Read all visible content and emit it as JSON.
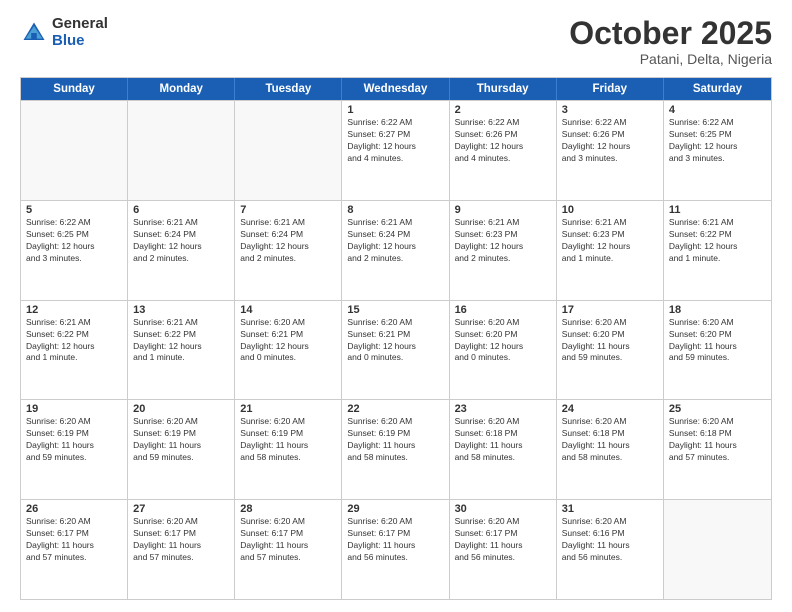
{
  "header": {
    "logo_general": "General",
    "logo_blue": "Blue",
    "title": "October 2025",
    "subtitle": "Patani, Delta, Nigeria"
  },
  "days": [
    "Sunday",
    "Monday",
    "Tuesday",
    "Wednesday",
    "Thursday",
    "Friday",
    "Saturday"
  ],
  "weeks": [
    [
      {
        "day": "",
        "info": ""
      },
      {
        "day": "",
        "info": ""
      },
      {
        "day": "",
        "info": ""
      },
      {
        "day": "1",
        "info": "Sunrise: 6:22 AM\nSunset: 6:27 PM\nDaylight: 12 hours\nand 4 minutes."
      },
      {
        "day": "2",
        "info": "Sunrise: 6:22 AM\nSunset: 6:26 PM\nDaylight: 12 hours\nand 4 minutes."
      },
      {
        "day": "3",
        "info": "Sunrise: 6:22 AM\nSunset: 6:26 PM\nDaylight: 12 hours\nand 3 minutes."
      },
      {
        "day": "4",
        "info": "Sunrise: 6:22 AM\nSunset: 6:25 PM\nDaylight: 12 hours\nand 3 minutes."
      }
    ],
    [
      {
        "day": "5",
        "info": "Sunrise: 6:22 AM\nSunset: 6:25 PM\nDaylight: 12 hours\nand 3 minutes."
      },
      {
        "day": "6",
        "info": "Sunrise: 6:21 AM\nSunset: 6:24 PM\nDaylight: 12 hours\nand 2 minutes."
      },
      {
        "day": "7",
        "info": "Sunrise: 6:21 AM\nSunset: 6:24 PM\nDaylight: 12 hours\nand 2 minutes."
      },
      {
        "day": "8",
        "info": "Sunrise: 6:21 AM\nSunset: 6:24 PM\nDaylight: 12 hours\nand 2 minutes."
      },
      {
        "day": "9",
        "info": "Sunrise: 6:21 AM\nSunset: 6:23 PM\nDaylight: 12 hours\nand 2 minutes."
      },
      {
        "day": "10",
        "info": "Sunrise: 6:21 AM\nSunset: 6:23 PM\nDaylight: 12 hours\nand 1 minute."
      },
      {
        "day": "11",
        "info": "Sunrise: 6:21 AM\nSunset: 6:22 PM\nDaylight: 12 hours\nand 1 minute."
      }
    ],
    [
      {
        "day": "12",
        "info": "Sunrise: 6:21 AM\nSunset: 6:22 PM\nDaylight: 12 hours\nand 1 minute."
      },
      {
        "day": "13",
        "info": "Sunrise: 6:21 AM\nSunset: 6:22 PM\nDaylight: 12 hours\nand 1 minute."
      },
      {
        "day": "14",
        "info": "Sunrise: 6:20 AM\nSunset: 6:21 PM\nDaylight: 12 hours\nand 0 minutes."
      },
      {
        "day": "15",
        "info": "Sunrise: 6:20 AM\nSunset: 6:21 PM\nDaylight: 12 hours\nand 0 minutes."
      },
      {
        "day": "16",
        "info": "Sunrise: 6:20 AM\nSunset: 6:20 PM\nDaylight: 12 hours\nand 0 minutes."
      },
      {
        "day": "17",
        "info": "Sunrise: 6:20 AM\nSunset: 6:20 PM\nDaylight: 11 hours\nand 59 minutes."
      },
      {
        "day": "18",
        "info": "Sunrise: 6:20 AM\nSunset: 6:20 PM\nDaylight: 11 hours\nand 59 minutes."
      }
    ],
    [
      {
        "day": "19",
        "info": "Sunrise: 6:20 AM\nSunset: 6:19 PM\nDaylight: 11 hours\nand 59 minutes."
      },
      {
        "day": "20",
        "info": "Sunrise: 6:20 AM\nSunset: 6:19 PM\nDaylight: 11 hours\nand 59 minutes."
      },
      {
        "day": "21",
        "info": "Sunrise: 6:20 AM\nSunset: 6:19 PM\nDaylight: 11 hours\nand 58 minutes."
      },
      {
        "day": "22",
        "info": "Sunrise: 6:20 AM\nSunset: 6:19 PM\nDaylight: 11 hours\nand 58 minutes."
      },
      {
        "day": "23",
        "info": "Sunrise: 6:20 AM\nSunset: 6:18 PM\nDaylight: 11 hours\nand 58 minutes."
      },
      {
        "day": "24",
        "info": "Sunrise: 6:20 AM\nSunset: 6:18 PM\nDaylight: 11 hours\nand 58 minutes."
      },
      {
        "day": "25",
        "info": "Sunrise: 6:20 AM\nSunset: 6:18 PM\nDaylight: 11 hours\nand 57 minutes."
      }
    ],
    [
      {
        "day": "26",
        "info": "Sunrise: 6:20 AM\nSunset: 6:17 PM\nDaylight: 11 hours\nand 57 minutes."
      },
      {
        "day": "27",
        "info": "Sunrise: 6:20 AM\nSunset: 6:17 PM\nDaylight: 11 hours\nand 57 minutes."
      },
      {
        "day": "28",
        "info": "Sunrise: 6:20 AM\nSunset: 6:17 PM\nDaylight: 11 hours\nand 57 minutes."
      },
      {
        "day": "29",
        "info": "Sunrise: 6:20 AM\nSunset: 6:17 PM\nDaylight: 11 hours\nand 56 minutes."
      },
      {
        "day": "30",
        "info": "Sunrise: 6:20 AM\nSunset: 6:17 PM\nDaylight: 11 hours\nand 56 minutes."
      },
      {
        "day": "31",
        "info": "Sunrise: 6:20 AM\nSunset: 6:16 PM\nDaylight: 11 hours\nand 56 minutes."
      },
      {
        "day": "",
        "info": ""
      }
    ]
  ]
}
